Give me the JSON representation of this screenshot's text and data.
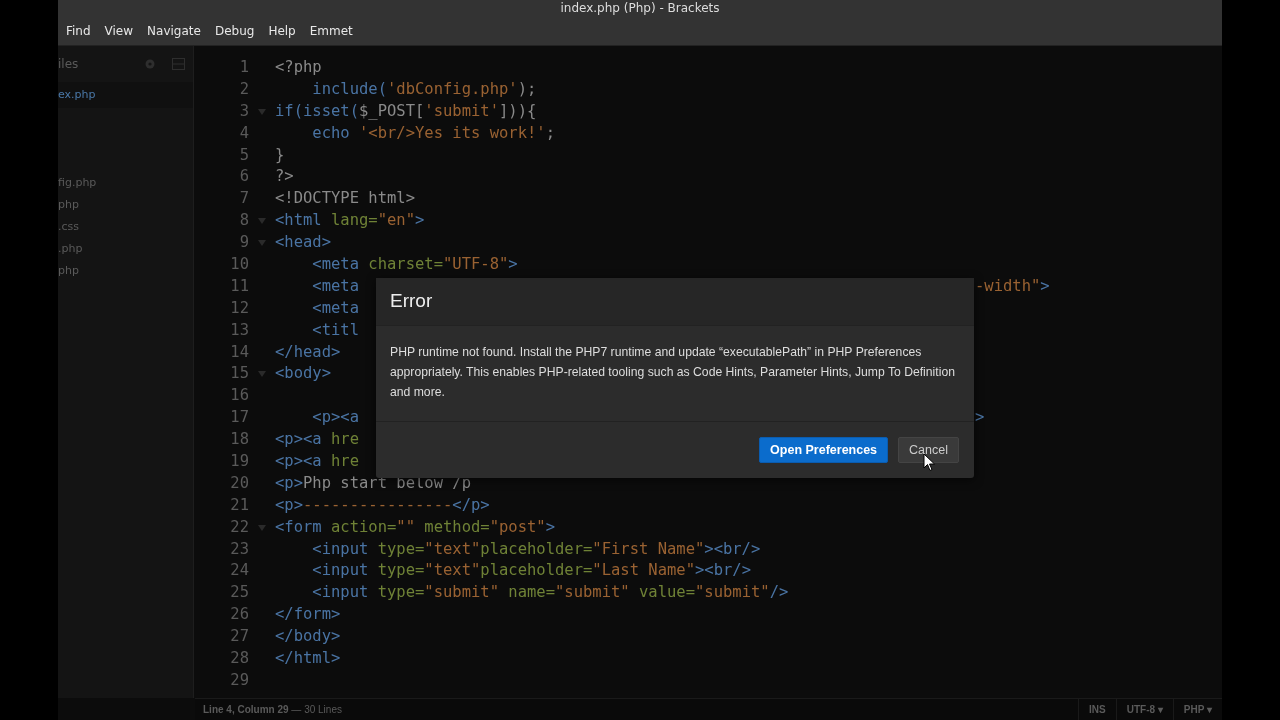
{
  "window": {
    "title": "index.php (Php) - Brackets"
  },
  "menu": [
    "Find",
    "View",
    "Navigate",
    "Debug",
    "Help",
    "Emmet"
  ],
  "sidebar": {
    "title": "iles",
    "items": [
      {
        "label": "ex.php",
        "selected": true
      },
      {
        "label": "fig.php",
        "selected": false
      },
      {
        "label": "php",
        "selected": false
      },
      {
        "label": ".css",
        "selected": false
      },
      {
        "label": ".php",
        "selected": false
      },
      {
        "label": "php",
        "selected": false
      }
    ]
  },
  "editor": {
    "lines": [
      {
        "number": "1",
        "fold": false,
        "tokens": [
          {
            "kind": "plain",
            "text": "<?php"
          }
        ]
      },
      {
        "number": "2",
        "fold": false,
        "tokens": [
          {
            "kind": "kw",
            "text": "    include("
          },
          {
            "kind": "str",
            "text": "'dbConfig.php'"
          },
          {
            "kind": "plain",
            "text": ");"
          }
        ]
      },
      {
        "number": "3",
        "fold": true,
        "tokens": [
          {
            "kind": "kw",
            "text": "if(isset("
          },
          {
            "kind": "plain",
            "text": "$_POST["
          },
          {
            "kind": "str",
            "text": "'submit'"
          },
          {
            "kind": "plain",
            "text": "])){"
          }
        ]
      },
      {
        "number": "4",
        "fold": false,
        "tokens": [
          {
            "kind": "kw",
            "text": "    echo "
          },
          {
            "kind": "str",
            "text": "'<br/>Yes its work!'"
          },
          {
            "kind": "plain",
            "text": ";"
          }
        ]
      },
      {
        "number": "5",
        "fold": false,
        "tokens": [
          {
            "kind": "plain",
            "text": "}"
          }
        ]
      },
      {
        "number": "6",
        "fold": false,
        "tokens": [
          {
            "kind": "plain",
            "text": "?>"
          }
        ]
      },
      {
        "number": "7",
        "fold": false,
        "tokens": [
          {
            "kind": "plain",
            "text": "<!DOCTYPE html>"
          }
        ]
      },
      {
        "number": "8",
        "fold": true,
        "tokens": [
          {
            "kind": "tag",
            "text": "<html "
          },
          {
            "kind": "attr",
            "text": "lang="
          },
          {
            "kind": "str",
            "text": "\"en\""
          },
          {
            "kind": "tag",
            "text": ">"
          }
        ]
      },
      {
        "number": "9",
        "fold": true,
        "tokens": [
          {
            "kind": "tag",
            "text": "<head>"
          }
        ]
      },
      {
        "number": "10",
        "fold": false,
        "tokens": [
          {
            "kind": "tag",
            "text": "    <meta "
          },
          {
            "kind": "attr",
            "text": "charset="
          },
          {
            "kind": "str",
            "text": "\"UTF-8\""
          },
          {
            "kind": "tag",
            "text": ">"
          }
        ]
      },
      {
        "number": "11",
        "fold": false,
        "tokens": [
          {
            "kind": "tag",
            "text": "    <meta"
          }
        ],
        "tail": [
          {
            "kind": "str",
            "text": "-width\""
          },
          {
            "kind": "tag",
            "text": ">"
          }
        ]
      },
      {
        "number": "12",
        "fold": false,
        "tokens": [
          {
            "kind": "tag",
            "text": "    <meta"
          }
        ]
      },
      {
        "number": "13",
        "fold": false,
        "tokens": [
          {
            "kind": "tag",
            "text": "    <titl"
          }
        ]
      },
      {
        "number": "14",
        "fold": false,
        "tokens": [
          {
            "kind": "tag",
            "text": "</head>"
          }
        ]
      },
      {
        "number": "15",
        "fold": true,
        "tokens": [
          {
            "kind": "tag",
            "text": "<body>"
          }
        ]
      },
      {
        "number": "16",
        "fold": false
      },
      {
        "number": "17",
        "fold": false,
        "tokens": [
          {
            "kind": "tag",
            "text": "    <p><a"
          }
        ],
        "tail": [
          {
            "kind": "tag",
            "text": ">"
          }
        ]
      },
      {
        "number": "18",
        "fold": false,
        "tokens": [
          {
            "kind": "tag",
            "text": "<p><a "
          },
          {
            "kind": "attr",
            "text": "hre"
          }
        ]
      },
      {
        "number": "19",
        "fold": false,
        "tokens": [
          {
            "kind": "tag",
            "text": "<p><a "
          },
          {
            "kind": "attr",
            "text": "hre"
          }
        ]
      },
      {
        "number": "20",
        "fold": false,
        "tokens": [
          {
            "kind": "tag",
            "text": "<p>"
          },
          {
            "kind": "plain",
            "text": "Php start below /p"
          }
        ]
      },
      {
        "number": "21",
        "fold": false,
        "tokens": [
          {
            "kind": "tag",
            "text": "<p>"
          },
          {
            "kind": "str",
            "text": "----------------"
          },
          {
            "kind": "tag",
            "text": "</p>"
          }
        ]
      },
      {
        "number": "22",
        "fold": true,
        "tokens": [
          {
            "kind": "tag",
            "text": "<form "
          },
          {
            "kind": "attr",
            "text": "action="
          },
          {
            "kind": "str",
            "text": "\"\""
          },
          {
            "kind": "attr",
            "text": " method="
          },
          {
            "kind": "str",
            "text": "\"post\""
          },
          {
            "kind": "tag",
            "text": ">"
          }
        ]
      },
      {
        "number": "23",
        "fold": false,
        "tokens": [
          {
            "kind": "tag",
            "text": "    <input "
          },
          {
            "kind": "attr",
            "text": "type="
          },
          {
            "kind": "str",
            "text": "\"text\""
          },
          {
            "kind": "attr",
            "text": "placeholder="
          },
          {
            "kind": "str",
            "text": "\"First Name\""
          },
          {
            "kind": "tag",
            "text": "><br/>"
          }
        ]
      },
      {
        "number": "24",
        "fold": false,
        "tokens": [
          {
            "kind": "tag",
            "text": "    <input "
          },
          {
            "kind": "attr",
            "text": "type="
          },
          {
            "kind": "str",
            "text": "\"text\""
          },
          {
            "kind": "attr",
            "text": "placeholder="
          },
          {
            "kind": "str",
            "text": "\"Last Name\""
          },
          {
            "kind": "tag",
            "text": "><br/>"
          }
        ]
      },
      {
        "number": "25",
        "fold": false,
        "tokens": [
          {
            "kind": "tag",
            "text": "    <input "
          },
          {
            "kind": "attr",
            "text": "type="
          },
          {
            "kind": "str",
            "text": "\"submit\""
          },
          {
            "kind": "attr",
            "text": " name="
          },
          {
            "kind": "str",
            "text": "\"submit\""
          },
          {
            "kind": "attr",
            "text": " value="
          },
          {
            "kind": "str",
            "text": "\"submit\""
          },
          {
            "kind": "tag",
            "text": "/>"
          }
        ]
      },
      {
        "number": "26",
        "fold": false,
        "tokens": [
          {
            "kind": "tag",
            "text": "</form>"
          }
        ]
      },
      {
        "number": "27",
        "fold": false,
        "tokens": [
          {
            "kind": "tag",
            "text": "</body>"
          }
        ]
      },
      {
        "number": "28",
        "fold": false,
        "tokens": [
          {
            "kind": "tag",
            "text": "</html>"
          }
        ]
      },
      {
        "number": "29",
        "fold": false
      }
    ]
  },
  "dialog": {
    "title": "Error",
    "message": "PHP runtime not found. Install the PHP7 runtime and update “executablePath” in PHP Preferences appropriately. This enables PHP-related tooling such as Code Hints, Parameter Hints, Jump To Definition and more.",
    "buttons": [
      {
        "label": "Open Preferences",
        "kind": "primary"
      },
      {
        "label": "Cancel",
        "kind": "secondary"
      }
    ]
  },
  "status_bar": {
    "position": "Line 4, Column 29",
    "line_count": "— 30 Lines",
    "mode": "INS",
    "encoding": "UTF-8 ▾",
    "language": "PHP ▾"
  }
}
